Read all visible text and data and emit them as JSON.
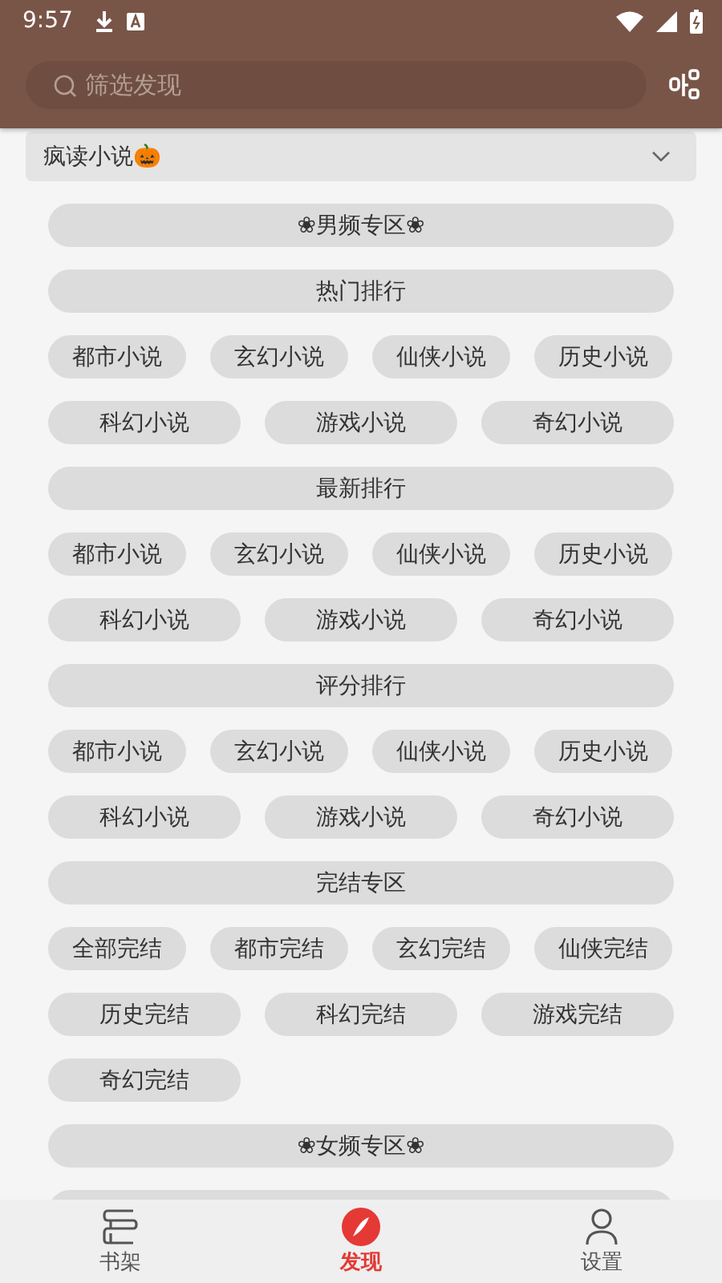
{
  "status_bar": {
    "time": "9:57"
  },
  "search": {
    "placeholder": "筛选发现"
  },
  "source": {
    "name": "疯读小说🎃"
  },
  "tags": [
    {
      "label": "❀男频专区❀",
      "kind": "full"
    },
    {
      "label": "热门排行",
      "kind": "full"
    },
    {
      "label": "都市小说",
      "kind": "quarter"
    },
    {
      "label": "玄幻小说",
      "kind": "quarter"
    },
    {
      "label": "仙侠小说",
      "kind": "quarter"
    },
    {
      "label": "历史小说",
      "kind": "quarter"
    },
    {
      "label": "科幻小说",
      "kind": "third"
    },
    {
      "label": "游戏小说",
      "kind": "third"
    },
    {
      "label": "奇幻小说",
      "kind": "third"
    },
    {
      "label": "最新排行",
      "kind": "full"
    },
    {
      "label": "都市小说",
      "kind": "quarter"
    },
    {
      "label": "玄幻小说",
      "kind": "quarter"
    },
    {
      "label": "仙侠小说",
      "kind": "quarter"
    },
    {
      "label": "历史小说",
      "kind": "quarter"
    },
    {
      "label": "科幻小说",
      "kind": "third"
    },
    {
      "label": "游戏小说",
      "kind": "third"
    },
    {
      "label": "奇幻小说",
      "kind": "third"
    },
    {
      "label": "评分排行",
      "kind": "full"
    },
    {
      "label": "都市小说",
      "kind": "quarter"
    },
    {
      "label": "玄幻小说",
      "kind": "quarter"
    },
    {
      "label": "仙侠小说",
      "kind": "quarter"
    },
    {
      "label": "历史小说",
      "kind": "quarter"
    },
    {
      "label": "科幻小说",
      "kind": "third"
    },
    {
      "label": "游戏小说",
      "kind": "third"
    },
    {
      "label": "奇幻小说",
      "kind": "third"
    },
    {
      "label": "完结专区",
      "kind": "full"
    },
    {
      "label": "全部完结",
      "kind": "quarter"
    },
    {
      "label": "都市完结",
      "kind": "quarter"
    },
    {
      "label": "玄幻完结",
      "kind": "quarter"
    },
    {
      "label": "仙侠完结",
      "kind": "quarter"
    },
    {
      "label": "历史完结",
      "kind": "third"
    },
    {
      "label": "科幻完结",
      "kind": "third"
    },
    {
      "label": "游戏完结",
      "kind": "third"
    },
    {
      "label": "奇幻完结",
      "kind": "third"
    },
    {
      "label": "❀女频专区❀",
      "kind": "full"
    },
    {
      "kind": "full"
    }
  ],
  "nav": [
    {
      "label": "书架",
      "selected": false
    },
    {
      "label": "发现",
      "selected": true
    },
    {
      "label": "设置",
      "selected": false
    }
  ]
}
